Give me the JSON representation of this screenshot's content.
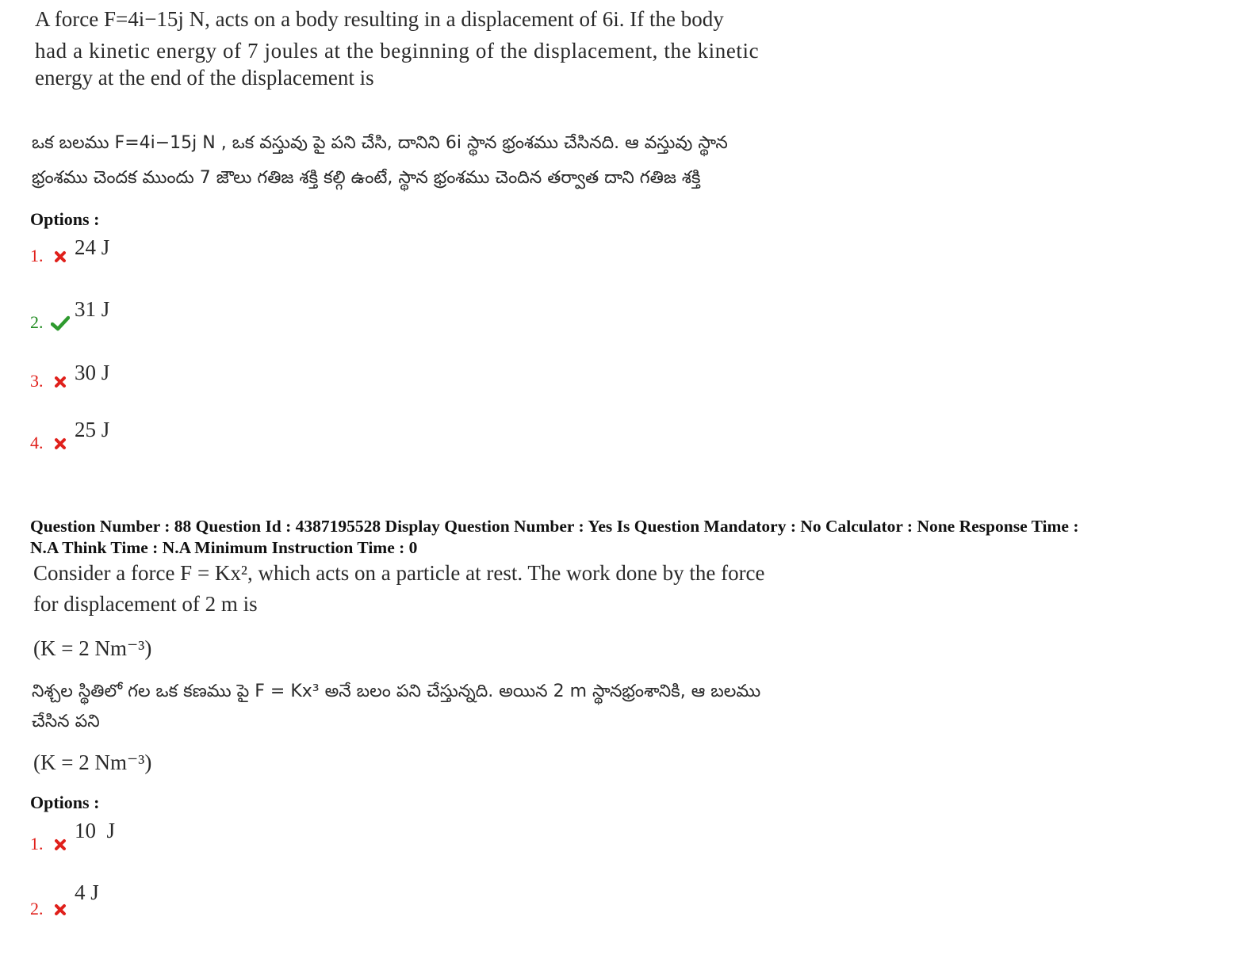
{
  "q87": {
    "english_lines": [
      "A force F=4i−15j N, acts on a body resulting in a displacement of 6i. If the body",
      "had a kinetic energy of 7 joules at the beginning of the displacement, the kinetic",
      "energy at the end of the displacement is"
    ],
    "telugu_lines": [
      "ఒక బలము  F=4i−15j N , ఒక వస్తువు పై పని చేసి, దానిని 6i స్థాన భ్రంశము చేసినది. ఆ వస్తువు స్థాన",
      "భ్రంశము చెందక ముందు 7 జౌలు గతిజ శక్తి కల్గి ఉంటే, స్థాన భ్రంశము చెందిన తర్వాత దాని గతిజ శక్తి"
    ],
    "options_label": "Options :",
    "options": [
      {
        "num": "1.",
        "value": "24 J",
        "status": "wrong"
      },
      {
        "num": "2.",
        "value": "31 J",
        "status": "correct"
      },
      {
        "num": "3.",
        "value": "30 J",
        "status": "wrong"
      },
      {
        "num": "4.",
        "value": "25 J",
        "status": "wrong"
      }
    ]
  },
  "q88": {
    "meta_lines": [
      "Question Number : 88 Question Id : 4387195528 Display Question Number : Yes Is Question Mandatory : No Calculator : None Response Time :",
      "N.A Think Time : N.A Minimum Instruction Time : 0"
    ],
    "english_lines": [
      "Consider a force F = Kx², which acts on a particle at rest. The work done by the force",
      "for displacement of 2 m is"
    ],
    "constant_line": "(K = 2 Nm⁻³)",
    "telugu_lines": [
      "నిశ్చల స్థితిలో గల ఒక కణము పై F = Kx³ అనే బలం పని చేస్తున్నది. అయిన 2 m స్థానభ్రంశానికి, ఆ బలము",
      "చేసిన పని"
    ],
    "constant_line_2": "(K = 2 Nm⁻³)",
    "options_label": "Options :",
    "options": [
      {
        "num": "1.",
        "value": "10  J",
        "status": "wrong"
      },
      {
        "num": "2.",
        "value": "4 J",
        "status": "wrong"
      }
    ]
  },
  "colors": {
    "wrong": "#e0201b",
    "correct": "#2e9a2e",
    "text": "#2a2a2a"
  },
  "icons": {
    "wrong": "cross-icon",
    "correct": "check-icon"
  }
}
